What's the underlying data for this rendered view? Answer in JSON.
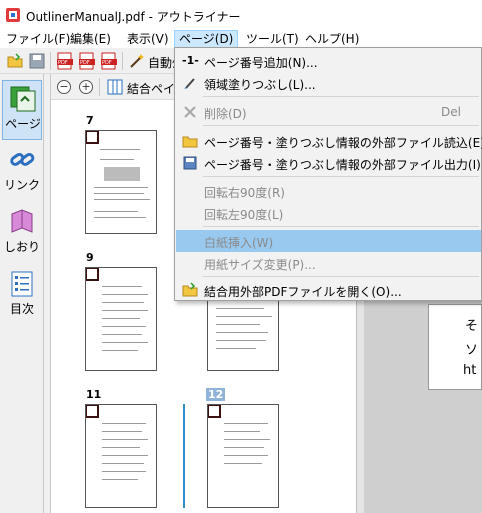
{
  "window": {
    "title": "OutlinerManualJ.pdf - アウトライナー"
  },
  "menubar": {
    "items": [
      {
        "label": "ファイル(F)"
      },
      {
        "label": "編集(E)"
      },
      {
        "label": "表示(V)"
      },
      {
        "label": "ページ(D)"
      },
      {
        "label": "ツール(T)"
      },
      {
        "label": "ヘルプ(H)"
      }
    ]
  },
  "toolbar": {
    "auto_label": "自動ﾀ",
    "page_add_hint": "-1-"
  },
  "sidebar": {
    "items": [
      {
        "label": "ページ"
      },
      {
        "label": "リンク"
      },
      {
        "label": "しおり"
      },
      {
        "label": "目次"
      }
    ]
  },
  "thumbnails": {
    "toolbar": {
      "zoom_out": "−",
      "zoom_in": "+",
      "merge_pane": "結合ペイン"
    },
    "pages": [
      {
        "number": "7"
      },
      {
        "number": "9"
      },
      {
        "number": "11"
      },
      {
        "number": "12"
      }
    ]
  },
  "right_panel": {
    "lines": [
      "そ",
      "ソ",
      "ht"
    ]
  },
  "page_menu": {
    "items": [
      {
        "label": "ページ番号追加(N)...",
        "shortcut": ""
      },
      {
        "label": "領域塗りつぶし(L)...",
        "shortcut": ""
      },
      {
        "label": "削除(D)",
        "shortcut": "Del"
      },
      {
        "label": "ページ番号・塗りつぶし情報の外部ファイル読込(E)...",
        "shortcut": ""
      },
      {
        "label": "ページ番号・塗りつぶし情報の外部ファイル出力(I)...",
        "shortcut": ""
      },
      {
        "label": "回転右90度(R)",
        "shortcut": ""
      },
      {
        "label": "回転左90度(L)",
        "shortcut": ""
      },
      {
        "label": "白紙挿入(W)",
        "shortcut": ""
      },
      {
        "label": "用紙サイズ変更(P)...",
        "shortcut": ""
      },
      {
        "label": "結合用外部PDFファイルを開く(O)...",
        "shortcut": ""
      }
    ]
  },
  "colors": {
    "menu_highlight": "#99c9ef",
    "active_menu": "#cce8ff",
    "selected_page": "#8fb4d8"
  }
}
